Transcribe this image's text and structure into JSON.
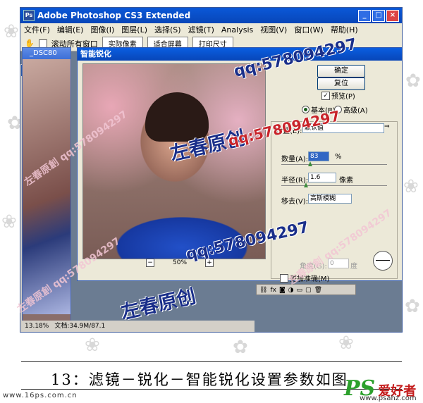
{
  "app": {
    "title": "Adobe Photoshop CS3 Extended"
  },
  "menu": [
    "文件(F)",
    "编辑(E)",
    "图像(I)",
    "图层(L)",
    "选择(S)",
    "滤镜(T)",
    "Analysis",
    "视图(V)",
    "窗口(W)",
    "帮助(H)"
  ],
  "options": {
    "scroll_all_label": "滚动所有窗口",
    "actual_pixels": "实际像素",
    "fit_screen": "适合屏幕",
    "print_size": "打印尺寸"
  },
  "document": {
    "title": "_DSC80",
    "zoom": "13.18%",
    "doc_info": "文档:34.9M/87.1"
  },
  "dialog": {
    "title": "智能锐化",
    "ok": "确定",
    "reset": "复位",
    "preview_label": "预览(P)",
    "preview_checked": true,
    "mode_basic": "基本(B)",
    "mode_advanced": "高级(A)",
    "settings_label": "设置(E):",
    "settings_value": "默认值",
    "amount_label": "数量(A):",
    "amount_value": "83",
    "amount_unit": "%",
    "radius_label": "半径(R):",
    "radius_value": "1.6",
    "radius_unit": "像素",
    "remove_label": "移去(V):",
    "remove_value": "高斯模糊",
    "angle_label": "角度(G):",
    "angle_value": "0",
    "angle_unit": "度",
    "more_accurate_label": "更加准确(M)",
    "zoom_value": "50%",
    "zoom_minus": "−",
    "zoom_plus": "+"
  },
  "watermarks": {
    "blue": "左春原创",
    "red": "qq:578094297",
    "pink": "左春原創 qq:578094297"
  },
  "caption": "13：滤镜－锐化－智能锐化设置参数如图",
  "footer_site": "www.16ps.com.cn",
  "logo": {
    "ps": "PS",
    "cn": "爱好者",
    "url": "www.psahz.com"
  }
}
